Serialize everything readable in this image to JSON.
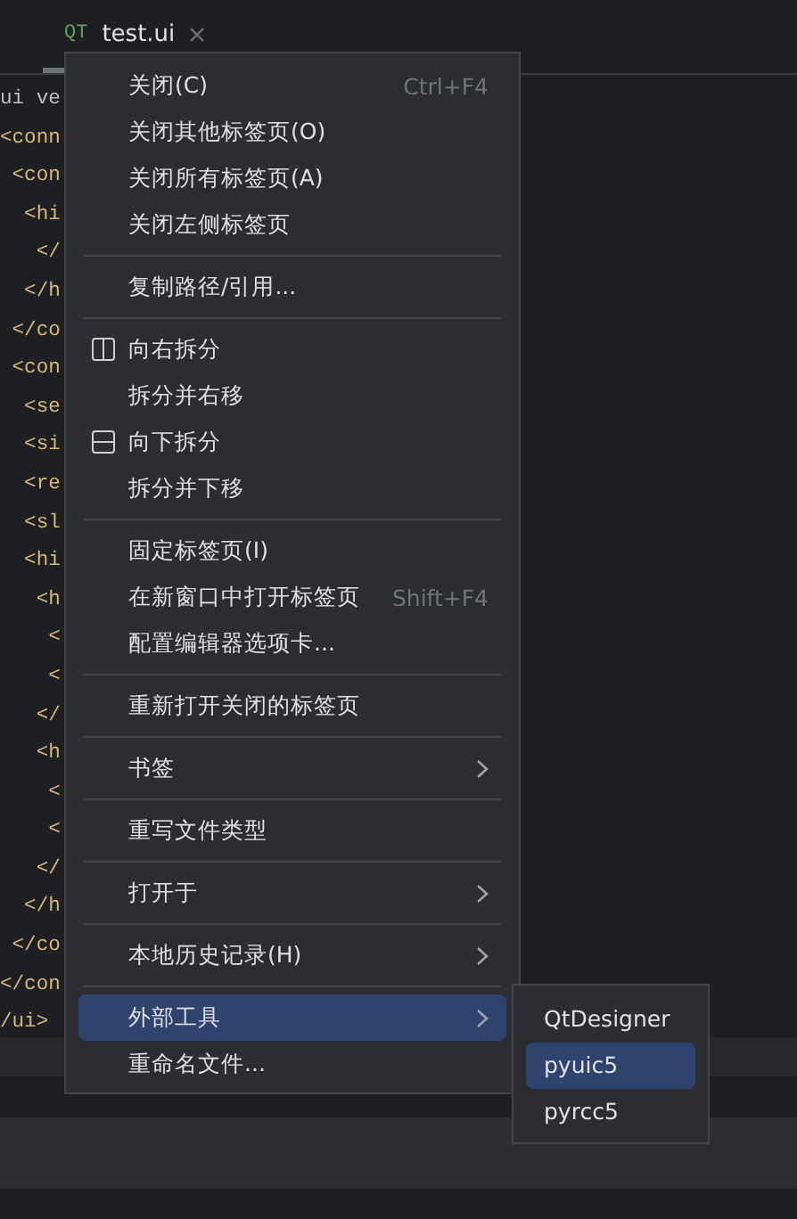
{
  "tab": {
    "badge": "QT",
    "title": "test.ui",
    "selected": true
  },
  "editor": {
    "lines": [
      {
        "kind": "text",
        "text": "ui ve"
      },
      {
        "kind": "tag",
        "text": "<conn"
      },
      {
        "kind": "tag",
        "text": " <con"
      },
      {
        "kind": "tag",
        "text": "  <hi"
      },
      {
        "kind": "tag",
        "text": "   </"
      },
      {
        "kind": "tag",
        "text": "  </h"
      },
      {
        "kind": "tag",
        "text": " </co"
      },
      {
        "kind": "tag",
        "text": " <con"
      },
      {
        "kind": "tag",
        "text": "  <se"
      },
      {
        "kind": "tag",
        "text": "  <si"
      },
      {
        "kind": "tag",
        "text": "  <re"
      },
      {
        "kind": "tag",
        "text": "  <sl"
      },
      {
        "kind": "tag",
        "text": "  <hi"
      },
      {
        "kind": "tag",
        "text": "   <h"
      },
      {
        "kind": "tag",
        "text": "    <"
      },
      {
        "kind": "tag",
        "text": "    <"
      },
      {
        "kind": "tag",
        "text": "   </"
      },
      {
        "kind": "tag",
        "text": "   <h"
      },
      {
        "kind": "tag",
        "text": "    <"
      },
      {
        "kind": "tag",
        "text": "    <"
      },
      {
        "kind": "tag",
        "text": "   </"
      },
      {
        "kind": "tag",
        "text": "  </h"
      },
      {
        "kind": "tag",
        "text": " </co"
      },
      {
        "kind": "tag",
        "text": "</con"
      },
      {
        "kind": "tag",
        "text": "/ui>"
      }
    ]
  },
  "context_menu": {
    "groups": [
      [
        {
          "label": "关闭(C)",
          "shortcut": "Ctrl+F4",
          "submenu": false,
          "selected": false
        },
        {
          "label": "关闭其他标签页(O)",
          "submenu": false,
          "selected": false
        },
        {
          "label": "关闭所有标签页(A)",
          "submenu": false,
          "selected": false
        },
        {
          "label": "关闭左侧标签页",
          "submenu": false,
          "selected": false
        }
      ],
      [
        {
          "label": "复制路径/引用...",
          "submenu": false,
          "selected": false
        }
      ],
      [
        {
          "label": "向右拆分",
          "kind": "split_right",
          "submenu": false,
          "selected": false
        },
        {
          "label": "拆分并右移",
          "submenu": false,
          "selected": false
        },
        {
          "label": "向下拆分",
          "kind": "split_down",
          "submenu": false,
          "selected": false
        },
        {
          "label": "拆分并下移",
          "submenu": false,
          "selected": false
        }
      ],
      [
        {
          "label": "固定标签页(I)",
          "submenu": false,
          "selected": false
        },
        {
          "label": "在新窗口中打开标签页",
          "shortcut": "Shift+F4",
          "submenu": false,
          "selected": false
        },
        {
          "label": "配置编辑器选项卡...",
          "submenu": false,
          "selected": false
        }
      ],
      [
        {
          "label": "重新打开关闭的标签页",
          "submenu": false,
          "selected": false
        }
      ],
      [
        {
          "label": "书签",
          "submenu": true,
          "selected": false
        }
      ],
      [
        {
          "label": "重写文件类型",
          "submenu": false,
          "selected": false
        }
      ],
      [
        {
          "label": "打开于",
          "submenu": true,
          "selected": false
        }
      ],
      [
        {
          "label": "本地历史记录(H)",
          "submenu": true,
          "selected": false
        }
      ],
      [
        {
          "label": "外部工具",
          "submenu": true,
          "selected": true
        },
        {
          "label": "重命名文件...",
          "submenu": false,
          "selected": false
        }
      ]
    ]
  },
  "submenu": {
    "items": [
      {
        "label": "QtDesigner",
        "selected": false
      },
      {
        "label": "pyuic5",
        "selected": true
      },
      {
        "label": "pyrcc5",
        "selected": false
      }
    ]
  }
}
